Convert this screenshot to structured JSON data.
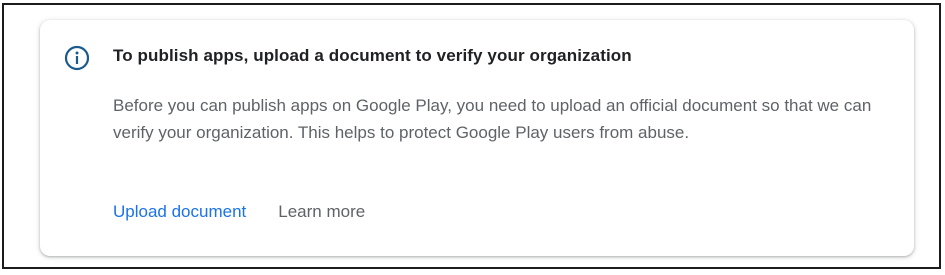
{
  "banner": {
    "icon": "info-icon",
    "title": "To publish apps, upload a document to verify your organization",
    "description": "Before you can publish apps on Google Play, you need to upload an official document so that we can verify your organization. This helps to protect Google Play users from abuse.",
    "actions": {
      "upload_label": "Upload document",
      "learn_more_label": "Learn more"
    },
    "colors": {
      "icon": "#1a5a8c",
      "link": "#1a73e8",
      "secondary_text": "#5f6368",
      "title_text": "#202124"
    }
  }
}
